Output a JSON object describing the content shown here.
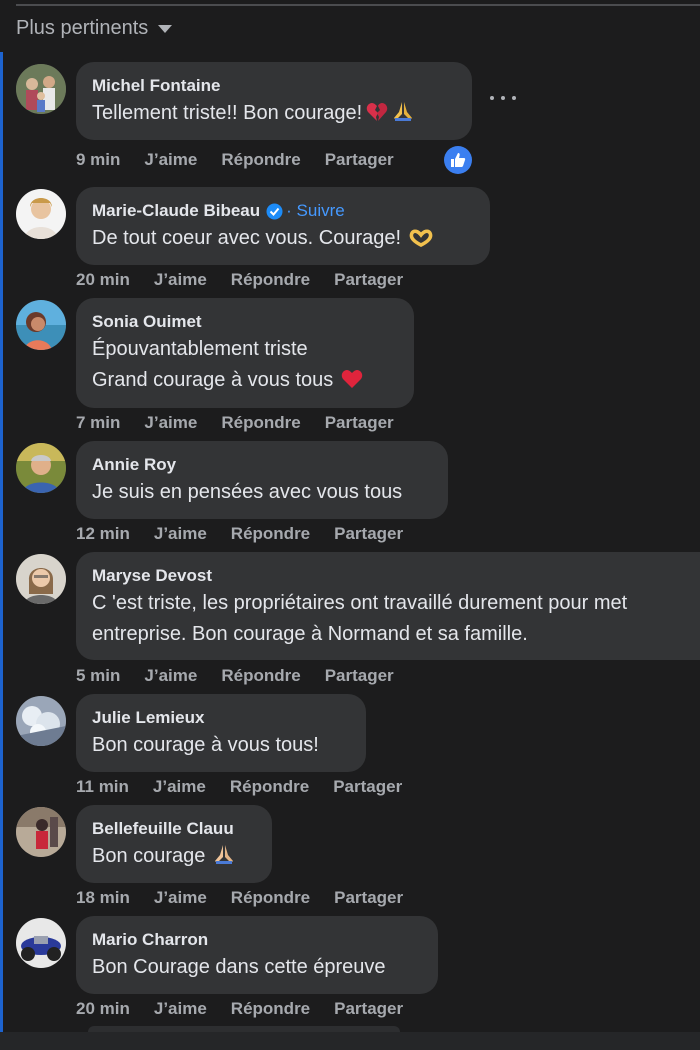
{
  "sort": {
    "label": "Plus pertinents"
  },
  "comments": [
    {
      "name": "Michel Fontaine",
      "lines": [
        "Tellement triste!! Bon courage!"
      ],
      "emoji": "broken-heart+pray",
      "time": "9 min",
      "like": "J’aime",
      "reply": "Répondre",
      "share": "Partager",
      "avatar": "family-photo"
    },
    {
      "name": "Marie-Claude Bibeau",
      "follow": "· Suivre",
      "lines": [
        "De tout coeur avec vous. Courage!"
      ],
      "emoji": "heart-hands",
      "time": "20 min",
      "like": "J’aime",
      "reply": "Répondre",
      "share": "Partager",
      "avatar": "woman-portrait"
    },
    {
      "name": "Sonia Ouimet",
      "lines": [
        "Épouvantablement triste",
        "Grand courage à vous tous"
      ],
      "emoji": "red-heart",
      "time": "7 min",
      "like": "J’aime",
      "reply": "Répondre",
      "share": "Partager",
      "avatar": "beach-photo"
    },
    {
      "name": "Annie Roy",
      "lines": [
        "Je suis en pensées avec vous tous"
      ],
      "time": "12 min",
      "like": "J’aime",
      "reply": "Répondre",
      "share": "Partager",
      "avatar": "man-outdoor"
    },
    {
      "name": "Maryse Devost",
      "lines": [
        "C 'est triste, les propriétaires ont travaillé durement pour met",
        "entreprise. Bon courage à Normand et sa famille."
      ],
      "time": "5 min",
      "like": "J’aime",
      "reply": "Répondre",
      "share": "Partager",
      "avatar": "woman-glasses"
    },
    {
      "name": "Julie Lemieux",
      "lines": [
        "Bon courage à vous tous!"
      ],
      "time": "11 min",
      "like": "J’aime",
      "reply": "Répondre",
      "share": "Partager",
      "avatar": "snow-photo"
    },
    {
      "name": "Bellefeuille Clauu",
      "lines": [
        "Bon courage"
      ],
      "emoji": "pray",
      "time": "18 min",
      "like": "J’aime",
      "reply": "Répondre",
      "share": "Partager",
      "avatar": "red-figure"
    },
    {
      "name": "Mario Charron",
      "lines": [
        "Bon Courage dans cette épreuve"
      ],
      "time": "20 min",
      "like": "J’aime",
      "reply": "Répondre",
      "share": "Partager",
      "avatar": "motorcycle"
    }
  ],
  "colors": {
    "background": "#1c1c1d",
    "bubble": "#333436",
    "link": "#4599ff",
    "accent": "#3b7ff0"
  }
}
